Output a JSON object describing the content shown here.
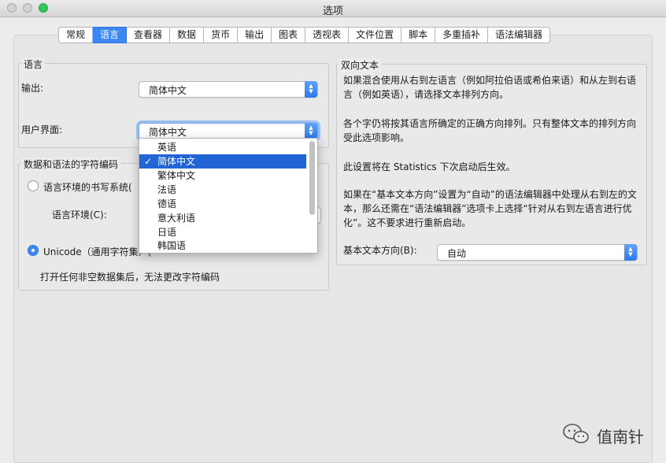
{
  "window": {
    "title": "选项"
  },
  "tabs": [
    {
      "label": "常规",
      "active": false
    },
    {
      "label": "语言",
      "active": true
    },
    {
      "label": "查看器",
      "active": false
    },
    {
      "label": "数据",
      "active": false
    },
    {
      "label": "货币",
      "active": false
    },
    {
      "label": "输出",
      "active": false
    },
    {
      "label": "图表",
      "active": false
    },
    {
      "label": "透视表",
      "active": false
    },
    {
      "label": "文件位置",
      "active": false
    },
    {
      "label": "脚本",
      "active": false
    },
    {
      "label": "多重插补",
      "active": false
    },
    {
      "label": "语法编辑器",
      "active": false
    }
  ],
  "language_group": {
    "title": "语言",
    "output_label": "输出:",
    "output_value": "简体中文",
    "ui_label": "用户界面:",
    "ui_value": "简体中文"
  },
  "ui_dropdown": {
    "options": [
      "英语",
      "简体中文",
      "繁体中文",
      "法语",
      "德语",
      "意大利语",
      "日语",
      "韩国语"
    ],
    "selected": "简体中文",
    "check_mark": "✓"
  },
  "encoding_group": {
    "title": "数据和语法的字符编码",
    "locale_option": "语言环境的书写系统(",
    "locale_label": "语言环境(C):",
    "unicode_option": "Unicode（通用字符集）(",
    "note": "打开任何非空数据集后，无法更改字符编码"
  },
  "bidi_group": {
    "title": "双向文本",
    "para1": "如果混合使用从右到左语言（例如阿拉伯语或希伯来语）和从左到右语言（例如英语），请选择文本排列方向。",
    "para2": "各个字仍将按其语言所确定的正确方向排列。只有整体文本的排列方向受此选项影响。",
    "para3": "此设置将在 Statistics 下次启动后生效。",
    "para4": "如果在“基本文本方向”设置为“自动”的语法编辑器中处理从右到左的文本，那么还需在“语法编辑器”选项卡上选择“针对从右到左语言进行优化”。这不要求进行重新启动。",
    "direction_label": "基本文本方向(B):",
    "direction_value": "自动"
  },
  "watermark": {
    "text": "值南针"
  },
  "colors": {
    "accent": "#3b88f2",
    "selection": "#2064d6"
  }
}
